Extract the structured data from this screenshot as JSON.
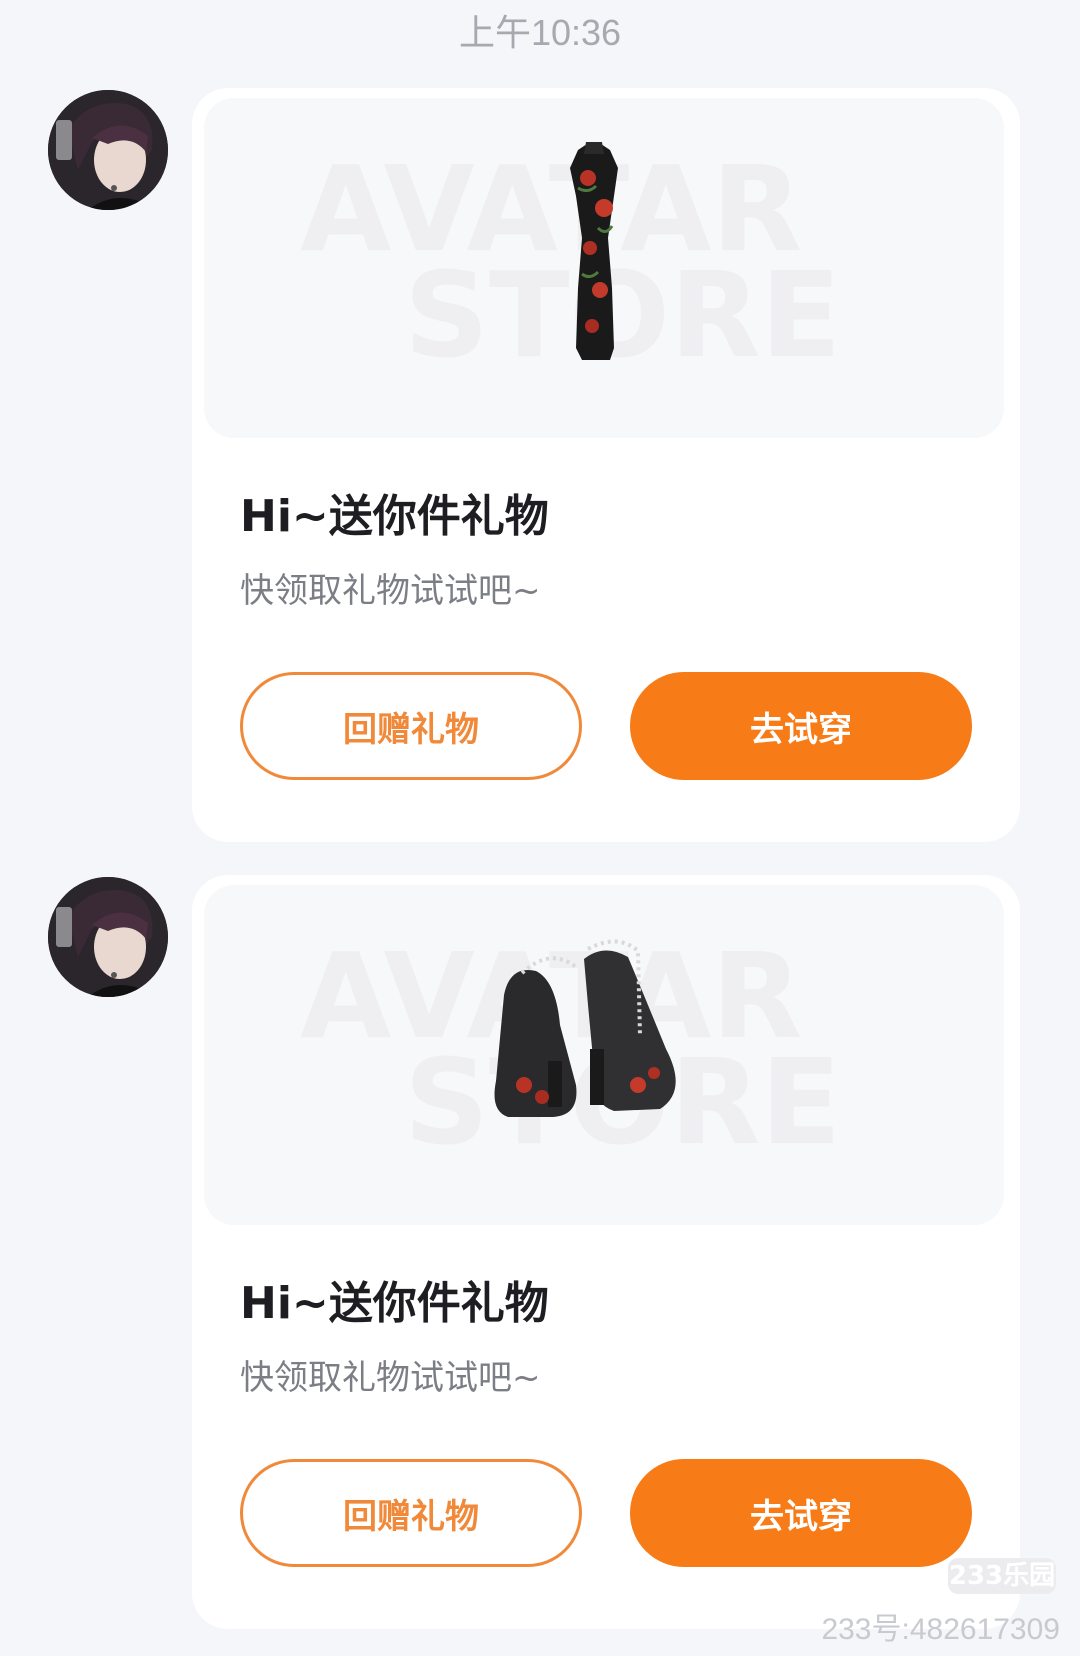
{
  "status": {
    "time": "上午10:36"
  },
  "colors": {
    "accent": "#F77B17",
    "accent_outline": "#F08A3A",
    "background": "#F5F6FA",
    "card": "#FFFFFF"
  },
  "messages": [
    {
      "item_icon": "qipao-dress-icon",
      "watermark_line1": "AVATAR",
      "watermark_line2": "STORE",
      "title": "Hi~送你件礼物",
      "subtitle": "快领取礼物试试吧~",
      "return_gift_label": "回赠礼物",
      "try_on_label": "去试穿"
    },
    {
      "item_icon": "high-heel-shoes-icon",
      "watermark_line1": "AVATAR",
      "watermark_line2": "STORE",
      "title": "Hi~送你件礼物",
      "subtitle": "快领取礼物试试吧~",
      "return_gift_label": "回赠礼物",
      "try_on_label": "去试穿"
    }
  ],
  "watermark": {
    "site": "233乐园",
    "id_text": "233号:482617309"
  }
}
